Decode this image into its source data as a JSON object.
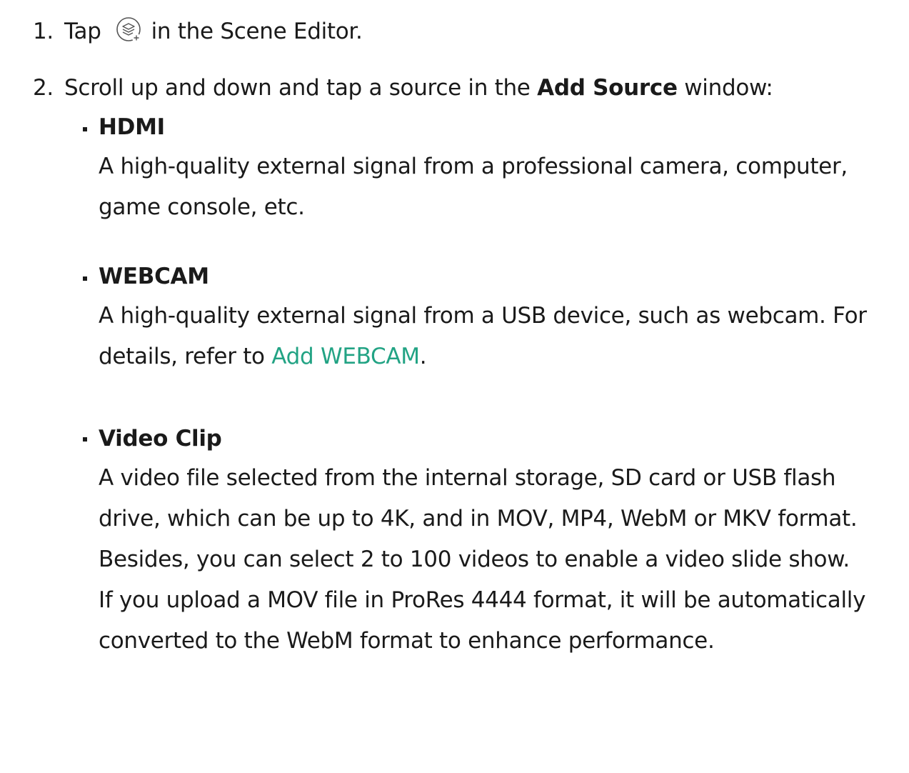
{
  "steps": [
    {
      "number": "1.",
      "before_icon": "Tap",
      "icon": "add-source-layers-icon",
      "after_icon": "in the Scene Editor."
    },
    {
      "number": "2.",
      "text_before": "Scroll up and down and tap a source in the ",
      "bold": "Add Source",
      "text_after": " window:"
    }
  ],
  "sources": [
    {
      "title": "HDMI",
      "description": "A high-quality external signal from a professional camera, computer, game console, etc."
    },
    {
      "title": "WEBCAM",
      "description_before": "A high-quality external signal from a USB device, such as webcam. For details, refer to ",
      "link": "Add WEBCAM",
      "description_after": "."
    },
    {
      "title": "Video Clip",
      "description": "A video file selected from the internal storage, SD card or USB flash drive, which can be up to 4K, and in MOV, MP4, WebM or MKV format. Besides, you can select 2 to 100 videos to enable a video slide show.",
      "note": "If you upload a MOV file in ProRes 4444 format, it will be automatically converted to the WebM format to enhance performance."
    }
  ],
  "colors": {
    "text": "#1a1a1a",
    "link": "#22a384",
    "icon_stroke": "#555555"
  }
}
